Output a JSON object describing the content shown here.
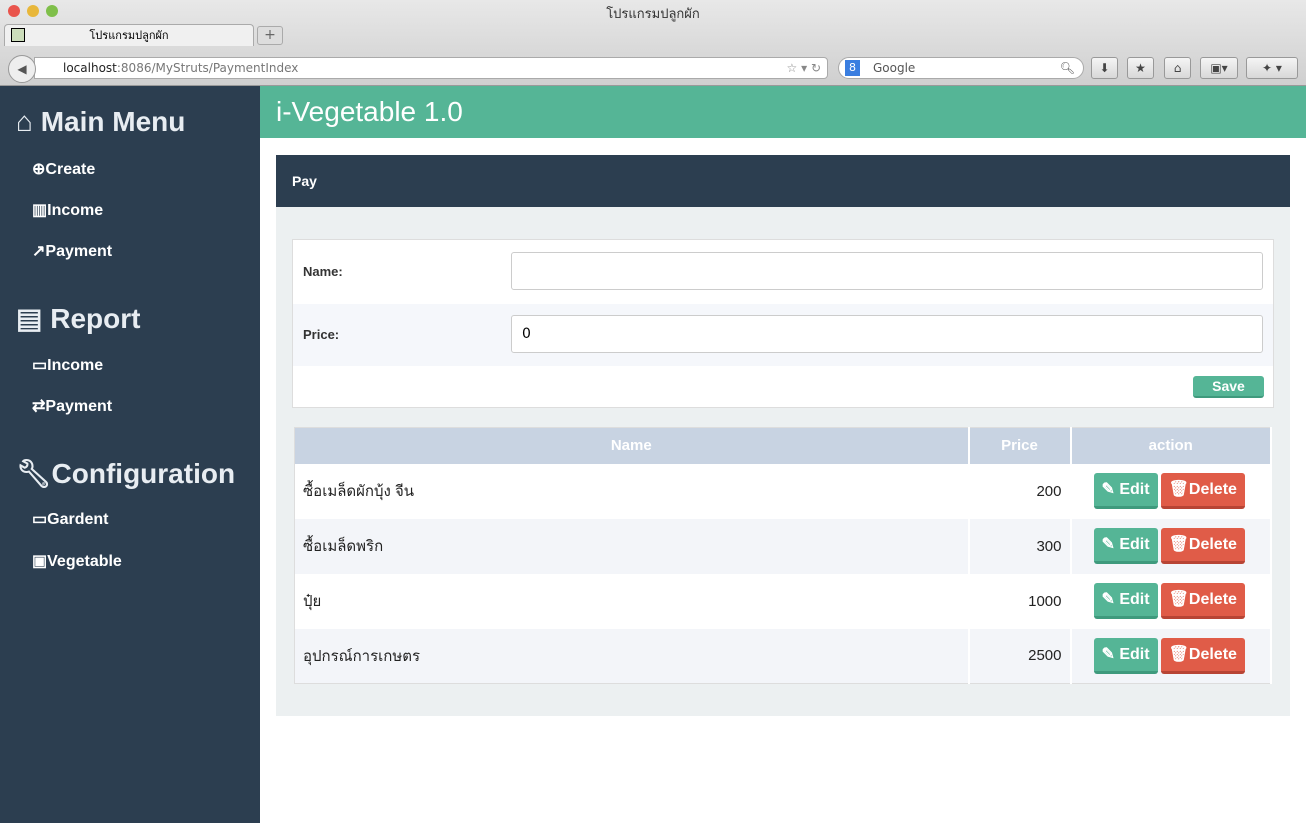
{
  "browser": {
    "window_title": "โปรแกรมปลูกผัก",
    "tab_title": "โปรแกรมปลูกผัก",
    "new_tab": "+",
    "url_host": "localhost",
    "url_rest": ":8086/MyStruts/PaymentIndex",
    "search_placeholder": "Google"
  },
  "sidebar": {
    "sections": [
      {
        "title": "Main Menu",
        "icon": "home-icon",
        "items": [
          {
            "label": "Create",
            "icon": "plus-circle-icon"
          },
          {
            "label": "Income",
            "icon": "bar-chart-icon"
          },
          {
            "label": "Payment",
            "icon": "external-link-icon"
          }
        ]
      },
      {
        "title": "Report",
        "icon": "list-alt-icon",
        "items": [
          {
            "label": "Income",
            "icon": "credit-card-icon"
          },
          {
            "label": "Payment",
            "icon": "exchange-icon"
          }
        ]
      },
      {
        "title": "Configuration",
        "icon": "wrench-icon",
        "items": [
          {
            "label": "Gardent",
            "icon": "folder-icon"
          },
          {
            "label": "Vegetable",
            "icon": "gift-icon"
          }
        ]
      }
    ]
  },
  "header": {
    "title": "i-Vegetable 1.0"
  },
  "panel": {
    "title": "Pay"
  },
  "form": {
    "name_label": "Name:",
    "name_value": "",
    "price_label": "Price:",
    "price_value": "0",
    "save_label": "Save"
  },
  "table": {
    "headers": [
      "Name",
      "Price",
      "action"
    ],
    "edit_label": "Edit",
    "delete_label": "Delete",
    "rows": [
      {
        "name": "ซื้อเมล็ดผักบุ้ง จีน",
        "price": "200"
      },
      {
        "name": "ซื้อเมล็ดพริก",
        "price": "300"
      },
      {
        "name": "ปุ๋ย",
        "price": "1000"
      },
      {
        "name": "อุปกรณ์การเกษตร",
        "price": "2500"
      }
    ]
  }
}
